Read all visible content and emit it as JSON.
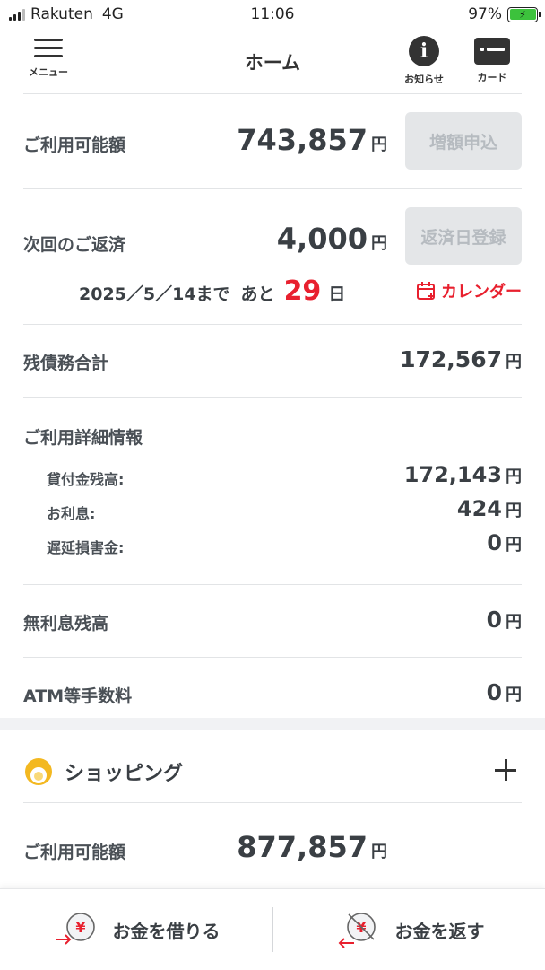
{
  "status_bar": {
    "carrier": "Rakuten",
    "network": "4G",
    "time": "11:06",
    "battery": "97%",
    "battery_color": "#3cc23c"
  },
  "header": {
    "menu_label": "メニュー",
    "title": "ホーム",
    "notice_label": "お知らせ",
    "card_label": "カード",
    "menu_icon": "hamburger-icon",
    "notice_icon": "info-icon",
    "card_icon": "card-icon"
  },
  "available": {
    "label": "ご利用可能額",
    "amount": "743,857",
    "unit": "円",
    "button": "増額申込"
  },
  "repayment": {
    "label": "次回のご返済",
    "amount": "4,000",
    "unit": "円",
    "button": "返済日登録",
    "due_date": "2025／5／14まで",
    "ato": "あと",
    "days": "29",
    "days_unit": "日",
    "calendar_link": "カレンダー",
    "calendar_icon": "calendar-icon",
    "accent_color": "#e8202e"
  },
  "debt_total": {
    "label": "残債務合計",
    "amount": "172,567",
    "unit": "円"
  },
  "usage_detail": {
    "label": "ご利用詳細情報",
    "items": [
      {
        "label": "貸付金残高:",
        "amount": "172,143",
        "unit": "円"
      },
      {
        "label": "お利息:",
        "amount": "424",
        "unit": "円"
      },
      {
        "label": "遅延損害金:",
        "amount": "0",
        "unit": "円"
      }
    ]
  },
  "no_interest": {
    "label": "無利息残高",
    "amount": "0",
    "unit": "円"
  },
  "atm_fee": {
    "label": "ATM等手数料",
    "amount": "0",
    "unit": "円"
  },
  "shopping": {
    "title": "ショッピング",
    "icon": "shopping-icon",
    "expand_icon": "plus-icon",
    "available_label": "ご利用可能額",
    "available_amount": "877,857",
    "unit": "円"
  },
  "bottom_bar": {
    "borrow_label": "お金を借りる",
    "borrow_icon": "borrow-yen-icon",
    "repay_label": "お金を返す",
    "repay_icon": "repay-yen-icon"
  }
}
